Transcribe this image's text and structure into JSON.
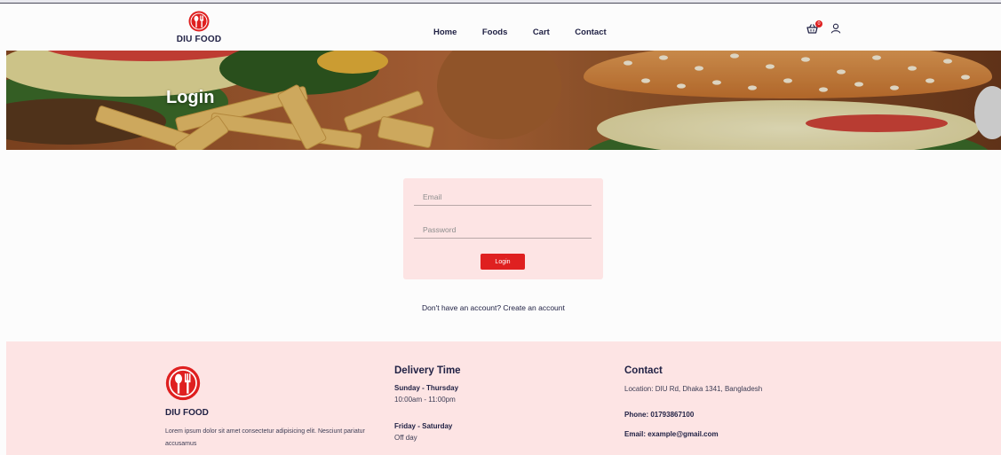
{
  "header": {
    "brand": "DIU FOOD",
    "nav": [
      "Home",
      "Foods",
      "Cart",
      "Contact"
    ],
    "cart_count": "0"
  },
  "hero": {
    "title": "Login"
  },
  "login_form": {
    "email_placeholder": "Email",
    "password_placeholder": "Password",
    "button_label": "Login"
  },
  "signup_prompt": "Don't have an account? Create an account",
  "footer": {
    "brand": "DIU FOOD",
    "description": "Lorem ipsum dolor sit amet consectetur adipisicing elit. Nesciunt pariatur accusamus",
    "delivery": {
      "title": "Delivery Time",
      "slots": [
        {
          "days": "Sunday - Thursday",
          "hours": "10:00am - 11:00pm"
        },
        {
          "days": "Friday - Saturday",
          "hours": "Off day"
        }
      ]
    },
    "contact": {
      "title": "Contact",
      "location": "Location: DIU Rd, Dhaka 1341, Bangladesh",
      "phone": "Phone: 01793867100",
      "email": "Email: example@gmail.com"
    }
  },
  "colors": {
    "primary_red": "#df2020",
    "navy_text": "#212245",
    "pink_background": "#fde4e4"
  },
  "icons": [
    "cutlery-logo-icon",
    "shopping-basket-icon",
    "user-icon"
  ]
}
